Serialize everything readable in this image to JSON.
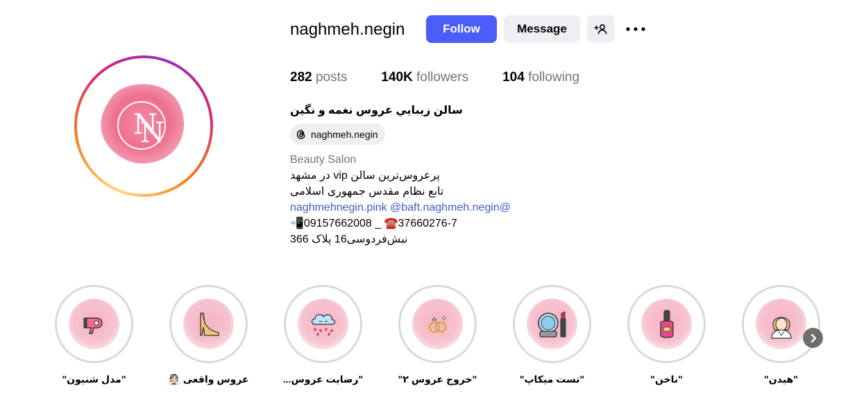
{
  "profile": {
    "username": "naghmeh.negin",
    "full_name": "سالن زيبايي عروس نغمه و نگین",
    "threads_handle": "naghmeh.negin",
    "category": "Beauty Salon",
    "bio_lines": [
      "پرعروس‌ترین سالن vip در مشهد",
      "تابع نظام مقدس جمهوری اسلامی",
      "naghmehnegin.pink @baft.naghmeh.negin@",
      "📲09157662008 _ ☎️37660276-7",
      "نبش‌فردوسی16 پلاک 366"
    ]
  },
  "actions": {
    "follow_label": "Follow",
    "message_label": "Message",
    "add_user_icon": "add-user-icon",
    "more_icon": "more-horizontal-icon"
  },
  "stats": {
    "posts_count": "282",
    "posts_label": "posts",
    "followers_count": "140K",
    "followers_label": "followers",
    "following_count": "104",
    "following_label": "following"
  },
  "highlights": [
    {
      "label": "\"مدل شنیون\"",
      "icon": "hair-dryer-icon"
    },
    {
      "label": "عروس واقعی 👰🏻",
      "icon": "high-heel-icon"
    },
    {
      "label": "\"رضایت عروس...",
      "icon": "cloud-hearts-icon"
    },
    {
      "label": "\"خروج عروس ۲\"",
      "icon": "wedding-rings-icon"
    },
    {
      "label": "\"تست میکاپ\"",
      "icon": "makeup-mirror-icon"
    },
    {
      "label": "\"ناخن\"",
      "icon": "nail-polish-icon"
    },
    {
      "label": "\"هیدن\"",
      "icon": "woman-avatar-icon"
    }
  ],
  "colors": {
    "follow_button": "#4a5df9",
    "secondary_button": "#efeff3",
    "link": "#4359c6",
    "muted_text": "#737373",
    "avatar_pink": "#ee6f8e"
  }
}
